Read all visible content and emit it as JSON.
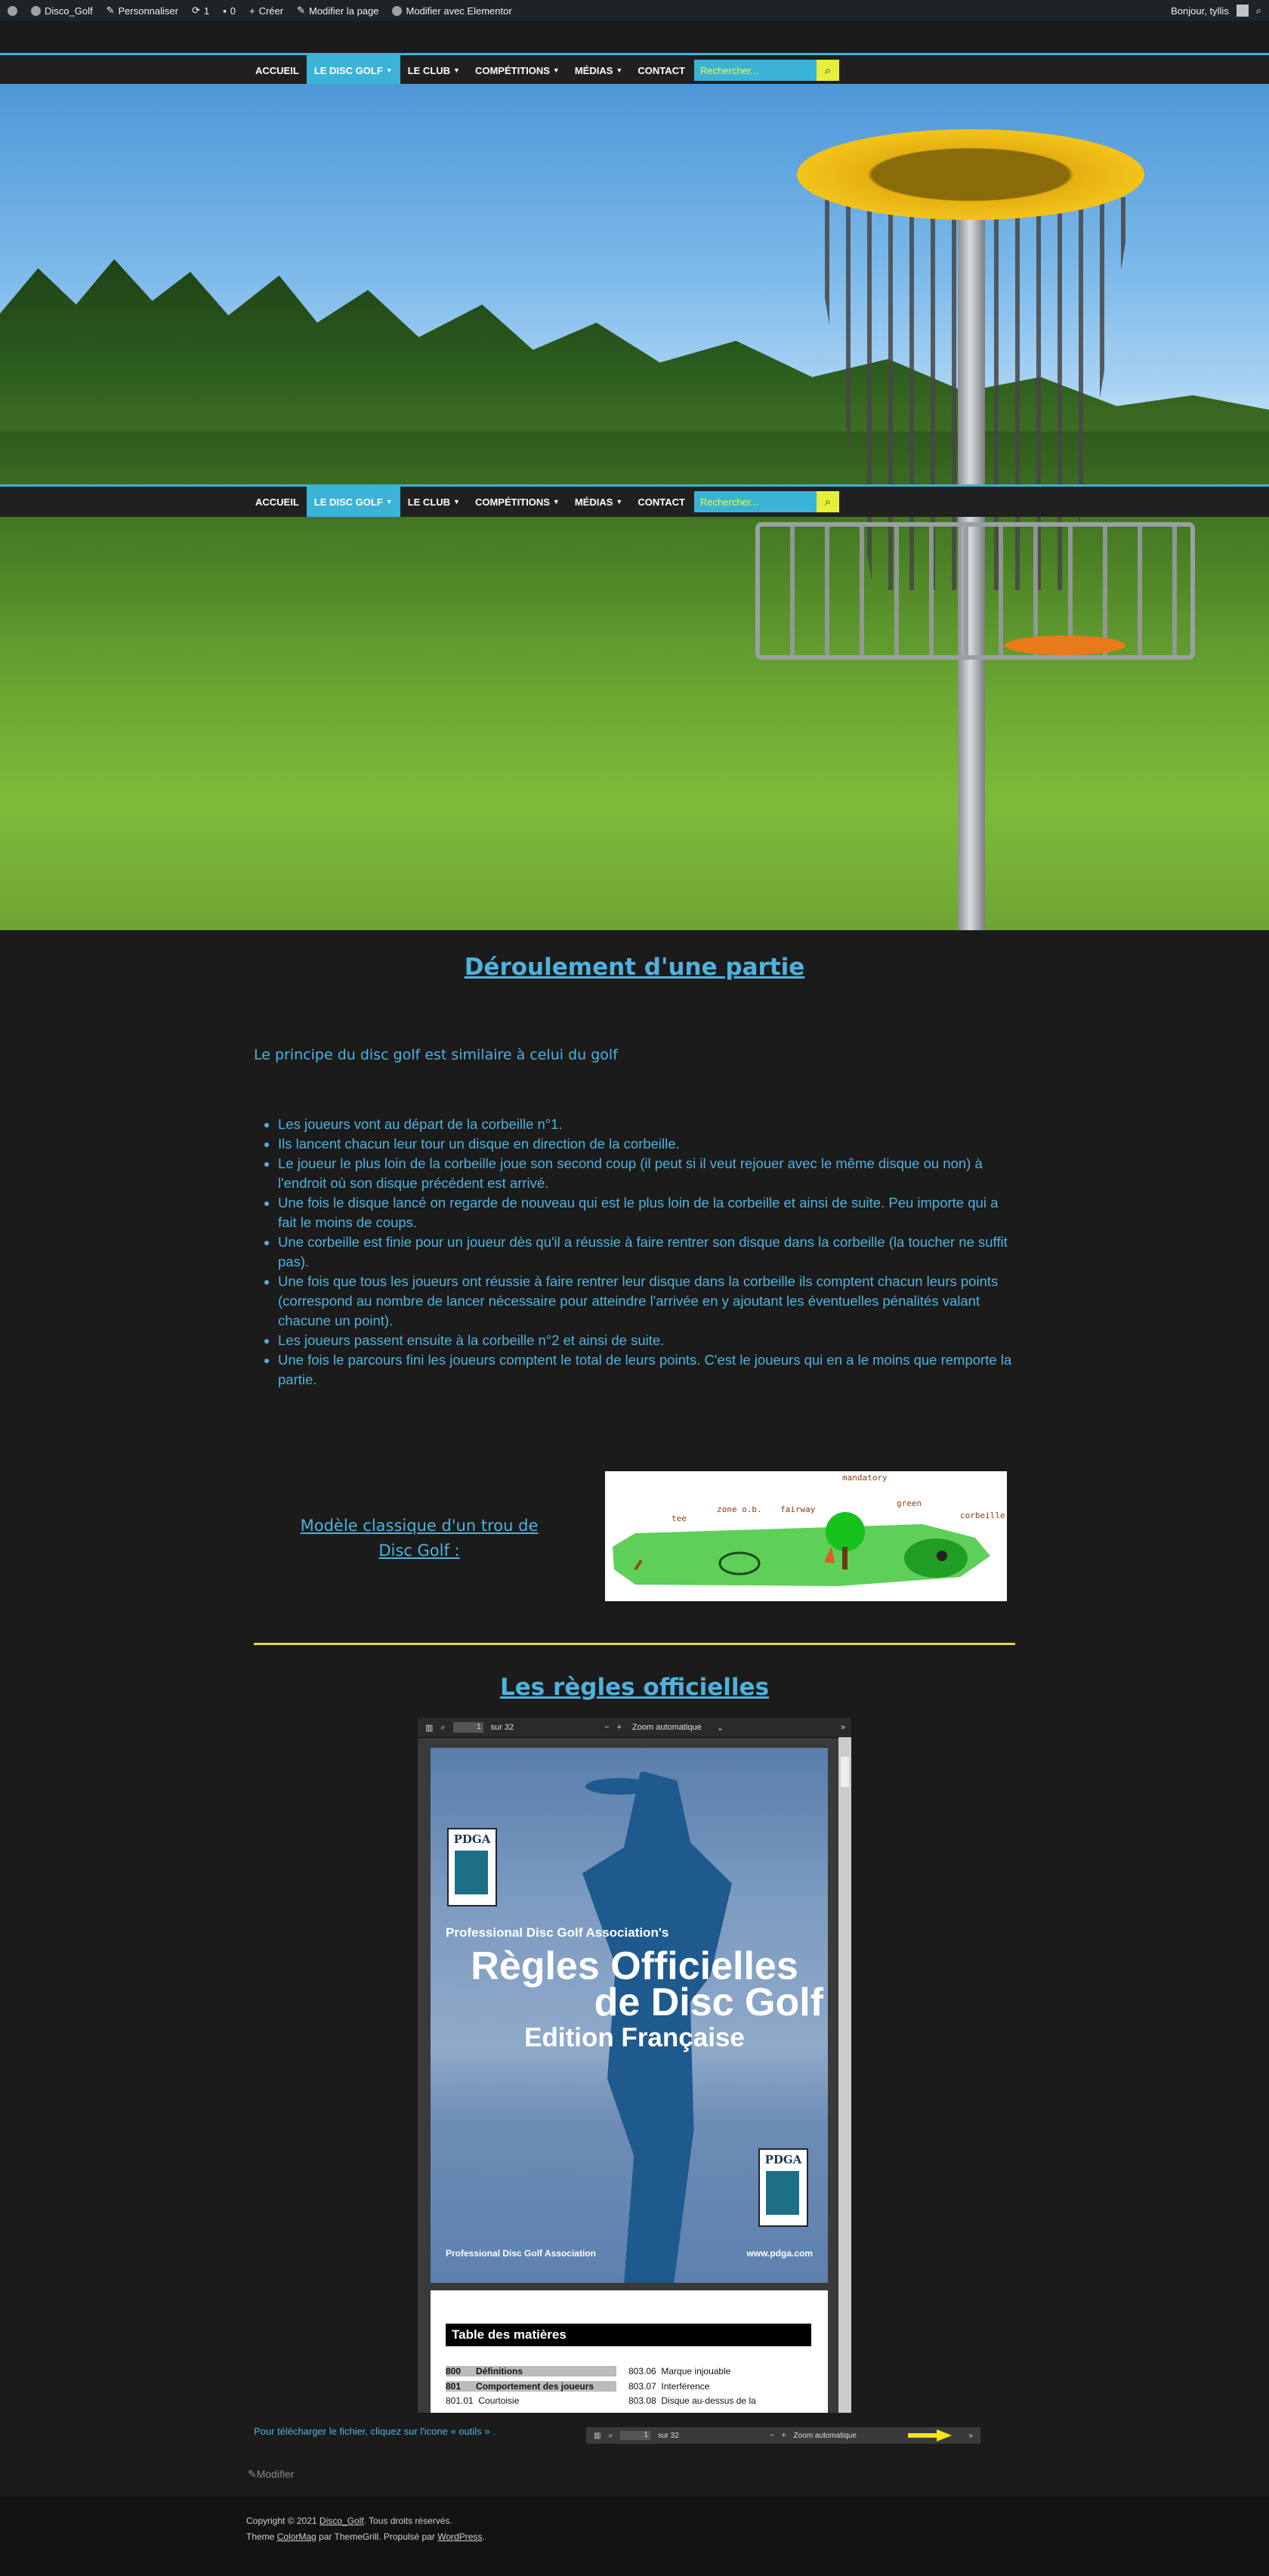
{
  "admin_bar": {
    "site_name": "Disco_Golf",
    "customize": "Personnaliser",
    "updates_count": "1",
    "comments_count": "0",
    "new": "Créer",
    "edit_page": "Modifier la page",
    "elementor": "Modifier avec Elementor",
    "greeting": "Bonjour, tyllis"
  },
  "nav": {
    "items": [
      {
        "label": "ACCUEIL"
      },
      {
        "label": "LE DISC GOLF"
      },
      {
        "label": "LE CLUB"
      },
      {
        "label": "COMPÉTITIONS"
      },
      {
        "label": "MÉDIAS"
      },
      {
        "label": "CONTACT"
      }
    ],
    "search_placeholder": "Rechercher...",
    "accent": "#3bb3d6",
    "search_button_color": "#e6ef3b"
  },
  "main": {
    "title": "Déroulement d'une partie",
    "intro": "Le principe du disc golf est similaire à celui du golf",
    "steps": [
      "Les joueurs vont au départ de la corbeille n°1.",
      "Ils lancent chacun leur tour un disque en direction de la corbeille.",
      "Le joueur le plus loin de la corbeille joue son second coup (il peut si il veut rejouer avec le même disque ou non) à l'endroit où son disque précédent est arrivé.",
      "Une fois le disque lancé on regarde de nouveau qui est le plus loin de la corbeille et ainsi de suite. Peu importe qui a fait le moins de coups.",
      "Une corbeille est finie pour un joueur dès qu'il a réussie à faire rentrer son disque dans la corbeille (la toucher ne suffit pas).",
      "Une fois que tous les joueurs ont réussie à faire rentrer leur disque dans la corbeille ils comptent chacun leurs points (correspond au nombre de lancer nécessaire pour atteindre l'arrivée en y ajoutant les éventuelles pénalités valant chacune un point).",
      "Les joueurs passent ensuite à la corbeille n°2 et ainsi de suite.",
      "Une fois le parcours fini les joueurs comptent le total de leurs points. C'est le joueurs qui en a le moins que remporte la partie."
    ],
    "model_line1": "Modèle classique d'un trou de",
    "model_line2": "Disc Golf :",
    "diagram_labels": {
      "tee": "tee",
      "zone": "zone o.b.",
      "fairway": "fairway",
      "mandatory": "mandatory",
      "green": "green",
      "corbeille": "corbeille"
    },
    "rules_title": "Les règles officielles",
    "accent_text": "#4fb2de",
    "divider_color": "#e6d93b"
  },
  "pdf": {
    "page_number": "1",
    "page_total": "sur 32",
    "zoom": "Zoom automatique",
    "cover": {
      "logo_text": "PDGA",
      "line1": "Professional Disc Golf Association's",
      "line2": "Règles Officielles",
      "line3": "de Disc Golf",
      "line4": "Edition Française",
      "bottom_left": "Professional Disc Golf Association",
      "bottom_right": "www.pdga.com"
    },
    "toc": {
      "title": "Table des matières",
      "left": [
        {
          "code": "800",
          "label": "Définitions"
        },
        {
          "code": "801",
          "label": "Comportement des joueurs"
        },
        {
          "code": "801.01",
          "label": "Courtoisie"
        }
      ],
      "right": [
        {
          "code": "803.06",
          "label": "Marque injouable"
        },
        {
          "code": "803.07",
          "label": "Interférence"
        },
        {
          "code": "803.08",
          "label": "Disque au-dessus de la"
        }
      ]
    }
  },
  "download_text": "Pour télécharger le fichier, cliquez sur l'icone « outils » .",
  "edit_link": "Modifier",
  "footer": {
    "copyright_prefix": "Copyright © 2021 ",
    "copyright_site": "Disco_Golf",
    "copyright_suffix": ". Tous droits réservés.",
    "theme_prefix": "Theme ",
    "theme_name": "ColorMag",
    "theme_by": " par ThemeGrill. Propulsé par ",
    "wordpress": "WordPress",
    "end": "."
  }
}
